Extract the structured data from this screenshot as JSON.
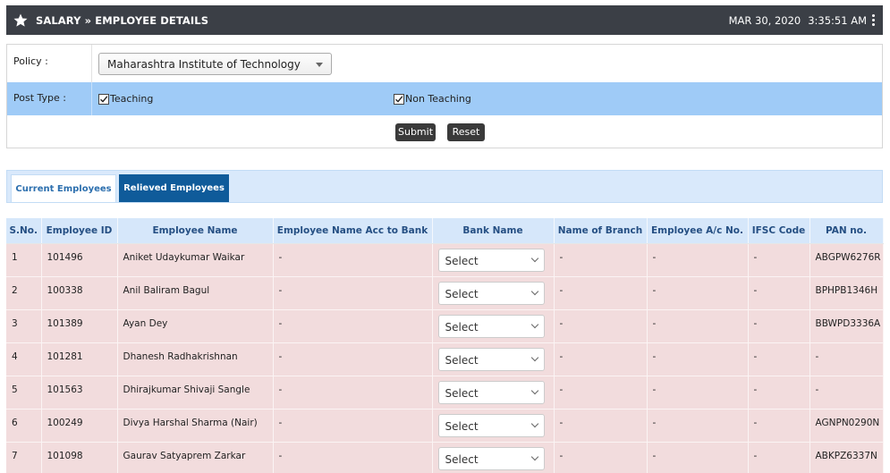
{
  "header": {
    "title": "SALARY » EMPLOYEE DETAILS",
    "date": "MAR 30, 2020",
    "time": "3:35:51 AM",
    "icon": "star-icon"
  },
  "form": {
    "policy_label": "Policy :",
    "policy_value": "Maharashtra Institute of Technology",
    "post_type_label": "Post Type :",
    "teaching_label": "Teaching",
    "teaching_checked": true,
    "non_teaching_label": "Non Teaching",
    "non_teaching_checked": true,
    "submit_label": "Submit",
    "reset_label": "Reset"
  },
  "tabs": [
    {
      "label": "Current Employees"
    },
    {
      "label": "Relieved Employees",
      "active": true
    }
  ],
  "table": {
    "headers": [
      "S.No.",
      "Employee ID",
      "Employee Name",
      "Employee Name Acc to Bank",
      "Bank Name",
      "Name of Branch",
      "Employee A/c No.",
      "IFSC Code",
      "PAN no."
    ],
    "rows": [
      {
        "sno": "1",
        "id": "101496",
        "name": "Aniket Udaykumar Waikar",
        "bank_name_acc": "-",
        "bank": "Select",
        "branch": "-",
        "account": "-",
        "ifsc": "-",
        "pan": "ABGPW6276R"
      },
      {
        "sno": "2",
        "id": "100338",
        "name": "Anil Baliram Bagul",
        "bank_name_acc": "-",
        "bank": "Select",
        "branch": "-",
        "account": "-",
        "ifsc": "-",
        "pan": "BPHPB1346H"
      },
      {
        "sno": "3",
        "id": "101389",
        "name": "Ayan Dey",
        "bank_name_acc": "-",
        "bank": "Select",
        "branch": "-",
        "account": "-",
        "ifsc": "-",
        "pan": "BBWPD3336A"
      },
      {
        "sno": "4",
        "id": "101281",
        "name": "Dhanesh Radhakrishnan",
        "bank_name_acc": "-",
        "bank": "Select",
        "branch": "-",
        "account": "-",
        "ifsc": "-",
        "pan": "-"
      },
      {
        "sno": "5",
        "id": "101563",
        "name": "Dhirajkumar Shivaji Sangle",
        "bank_name_acc": "-",
        "bank": "Select",
        "branch": "-",
        "account": "-",
        "ifsc": "-",
        "pan": "-"
      },
      {
        "sno": "6",
        "id": "100249",
        "name": "Divya Harshal Sharma (Nair)",
        "bank_name_acc": "-",
        "bank": "Select",
        "branch": "-",
        "account": "-",
        "ifsc": "-",
        "pan": "AGNPN0290N"
      },
      {
        "sno": "7",
        "id": "101098",
        "name": "Gaurav Satyaprem Zarkar",
        "bank_name_acc": "-",
        "bank": "Select",
        "branch": "-",
        "account": "-",
        "ifsc": "-",
        "pan": "ABKPZ6337N"
      }
    ]
  }
}
